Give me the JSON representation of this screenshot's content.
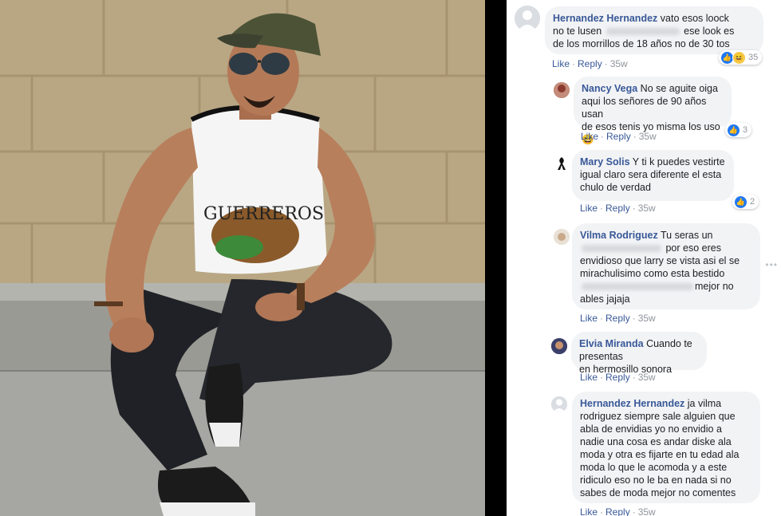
{
  "photo": {
    "shirt_text": "GUERREROS"
  },
  "comments": [
    {
      "author": "Hernandez Hernandez",
      "lines": [
        "vato esos loock",
        "no te lusen",
        "ese look es",
        "de los morrillos de 18 años no de 30 tos"
      ],
      "like_label": "Like",
      "reply_label": "Reply",
      "time": "35w",
      "reactions": {
        "count": "35",
        "icons": [
          "like-icon",
          "haha-icon"
        ]
      }
    },
    {
      "author": "Nancy Vega",
      "lines": [
        "No se aguite oiga",
        "aqui los señores de 90 años usan",
        "de esos tenis yo misma los uso😆"
      ],
      "like_label": "Like",
      "reply_label": "Reply",
      "time": "35w",
      "reactions": {
        "count": "3",
        "icons": [
          "like-icon"
        ]
      }
    },
    {
      "author": "Mary Solis",
      "lines": [
        "Y ti k puedes vestirte",
        "igual claro sera diferente el esta",
        "chulo de verdad"
      ],
      "like_label": "Like",
      "reply_label": "Reply",
      "time": "35w",
      "reactions": {
        "count": "2",
        "icons": [
          "like-icon"
        ]
      }
    },
    {
      "author": "Vilma Rodriguez",
      "lines": [
        "Tu seras un",
        "por eso eres",
        "envidioso que larry se vista asi el se",
        "mirachulisimo como esta bestido",
        "mejor no",
        "ables jajaja"
      ],
      "like_label": "Like",
      "reply_label": "Reply",
      "time": "35w"
    },
    {
      "author": "Elvia Miranda",
      "lines": [
        "Cuando te presentas",
        "en hermosillo sonora"
      ],
      "like_label": "Like",
      "reply_label": "Reply",
      "time": "35w"
    },
    {
      "author": "Hernandez Hernandez",
      "lines": [
        "ja vilma",
        "rodriguez siempre sale alguien que",
        "abla de envidias yo no envidio a",
        "nadie una cosa es andar diske ala",
        "moda y otra es fijarte en tu edad ala",
        "moda lo que le acomoda y a este",
        "ridiculo eso no le ba en nada si no",
        "sabes de moda mejor no comentes"
      ],
      "like_label": "Like",
      "reply_label": "Reply",
      "time": "35w"
    }
  ],
  "colors": {
    "link": "#385898",
    "bubble": "#f2f3f5",
    "like": "#2078f4"
  }
}
